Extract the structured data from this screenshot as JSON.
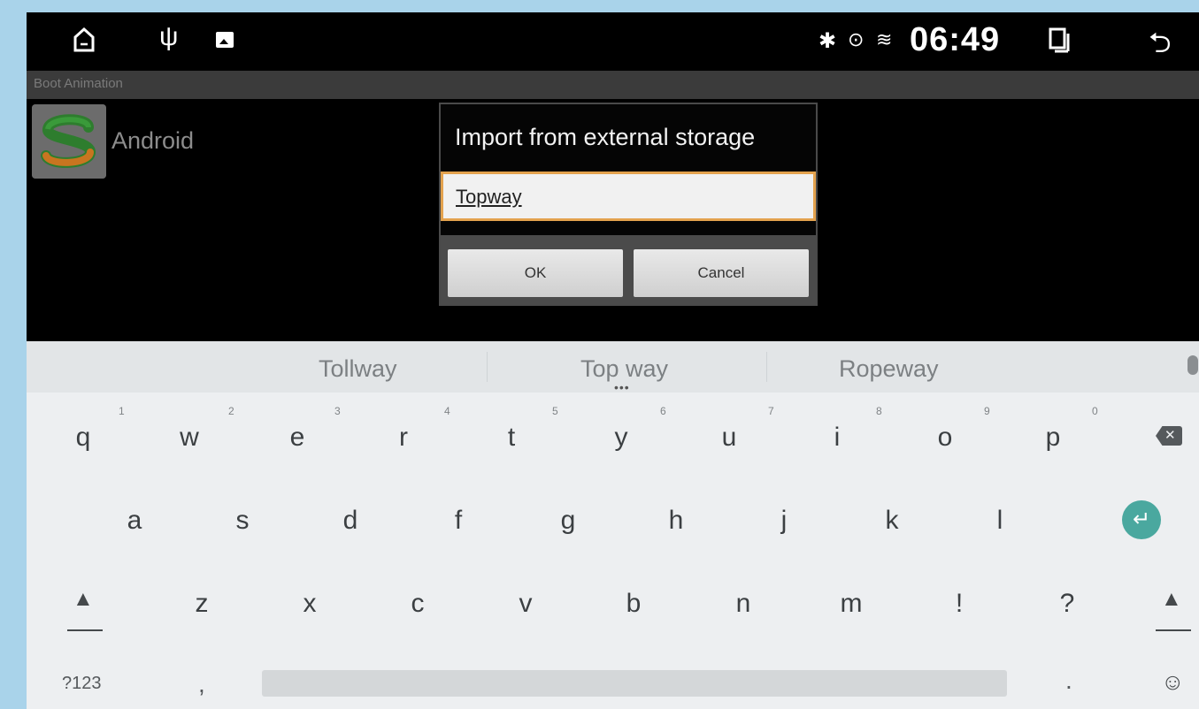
{
  "status_bar": {
    "icons": [
      "home-icon",
      "usb-icon",
      "gallery-icon",
      "bluetooth-icon",
      "location-icon",
      "wifi-icon",
      "recents-icon",
      "back-icon"
    ],
    "time": "06:49"
  },
  "app_bar": {
    "title": "Boot Animation"
  },
  "app_list": [
    {
      "label": "Android",
      "icon": "app-logo-icon"
    }
  ],
  "dialog": {
    "title": "Import from external storage",
    "input_value": "Topway",
    "ok_label": "OK",
    "cancel_label": "Cancel",
    "accent_color": "#e3a24e"
  },
  "keyboard": {
    "suggestions": [
      "Tollway",
      "Top way",
      "Ropeway"
    ],
    "suggestion_more": "•••",
    "rows": [
      [
        "q",
        "w",
        "e",
        "r",
        "t",
        "y",
        "u",
        "i",
        "o",
        "p"
      ],
      [
        "a",
        "s",
        "d",
        "f",
        "g",
        "h",
        "j",
        "k",
        "l"
      ],
      [
        "z",
        "x",
        "c",
        "v",
        "b",
        "n",
        "m",
        "!",
        "?"
      ]
    ],
    "number_hints": [
      "1",
      "2",
      "3",
      "4",
      "5",
      "6",
      "7",
      "8",
      "9",
      "0"
    ],
    "symbols_key": "?123",
    "comma_key": ",",
    "period_key": ".",
    "enter_color": "#4aa89f"
  }
}
